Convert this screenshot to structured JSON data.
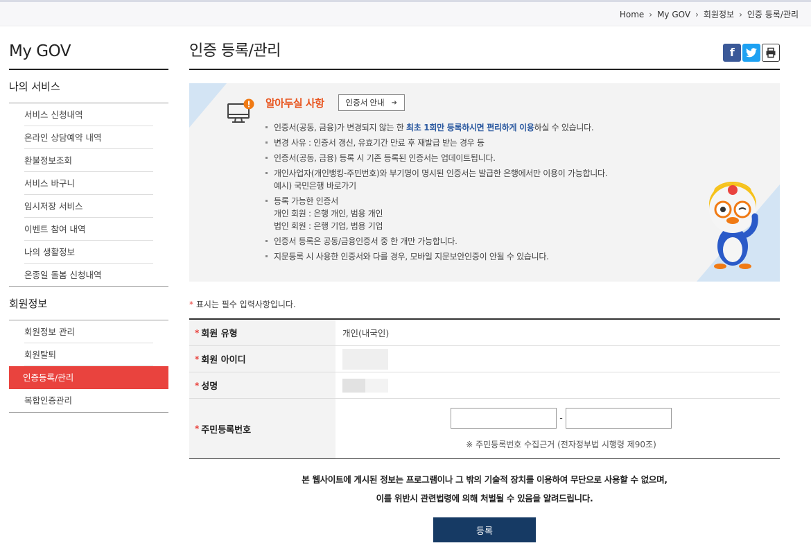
{
  "breadcrumb": [
    "Home",
    "My GOV",
    "회원정보",
    "인증 등록/관리"
  ],
  "sidebar": {
    "title": "My GOV",
    "sections": [
      {
        "label": "나의 서비스",
        "items": [
          "서비스 신청내역",
          "온라인 상담예약 내역",
          "환불정보조회",
          "서비스 바구니",
          "임시저장 서비스",
          "이벤트 참여 내역",
          "나의 생활정보",
          "온종일 돌봄 신청내역"
        ]
      },
      {
        "label": "회원정보",
        "items": [
          "회원정보 관리",
          "회원탈퇴",
          "인증등록/관리",
          "복합인증관리"
        ],
        "active_index": 2
      }
    ]
  },
  "page": {
    "title": "인증 등록/관리",
    "share": {
      "facebook": "f",
      "twitter": "t",
      "print": "⎙"
    }
  },
  "notice": {
    "title": "알아두실 사항",
    "guide_button": "인증서 안내",
    "items": [
      {
        "pre": "인증서(공동, 금융)가 변경되지 않는 한 ",
        "hl": "최초 1회만 등록하시면 편리하게 이용",
        "post": "하실 수 있습니다."
      },
      {
        "text": "변경 사유 : 인증서 갱신, 유효기간 만료 후 재발급 받는 경우 등"
      },
      {
        "text": "인증서(공동, 금융) 등록 시 기존 등록된 인증서는 업데이트됩니다."
      },
      {
        "text": "개인사업자(개인뱅킹-주민번호)와 부기명이 명시된 인증서는 발급한 은행에서만 이용이 가능합니다.",
        "sub": [
          "예시) 국민은행 바로가기"
        ]
      },
      {
        "text": "등록 가능한 인증서",
        "sub": [
          "개인 회원 : 은행 개인, 범용 개인",
          "법인 회원 : 은행 기업, 범용 기업"
        ]
      },
      {
        "text": "인증서 등록은 공동/금융인증서 중 한 개만 가능합니다."
      },
      {
        "text": "지문등록 시 사용한 인증서와 다를 경우, 모바일 지문보안인증이 안될 수 있습니다."
      }
    ]
  },
  "form": {
    "required_star": "*",
    "required_note": "표시는 필수 입력사항입니다.",
    "rows": {
      "member_type": {
        "label": "회원 유형",
        "value": "개인(내국인)"
      },
      "member_id": {
        "label": "회원 아이디"
      },
      "name": {
        "label": "성명"
      },
      "resident_no": {
        "label": "주민등록번호",
        "separator": "-",
        "note": "※ 주민등록번호 수집근거 (전자정부법 시행령 제90조)"
      }
    }
  },
  "legal": {
    "line1": "본 웹사이트에 게시된 정보는 프로그램이나 그 밖의 기술적 장치를 이용하여 무단으로 사용할 수 없으며,",
    "line2": "이를 위반시 관련법령에 의해 처벌될 수 있음을 알려드립니다."
  },
  "submit_label": "등록",
  "colors": {
    "accent": "#e9433e",
    "notice_title": "#e8541e",
    "submit_bg": "#163a64",
    "highlight": "#2c5aa0"
  }
}
